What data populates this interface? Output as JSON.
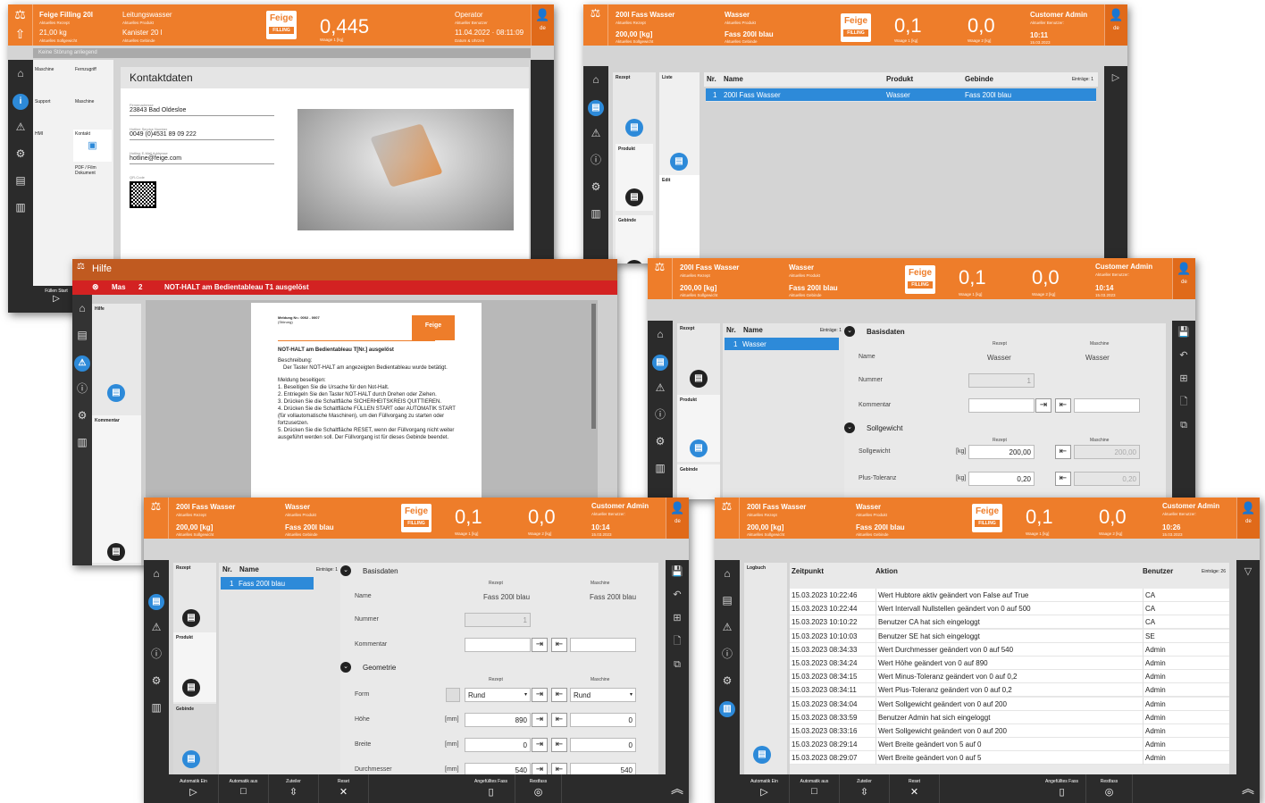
{
  "s1": {
    "title": "Feige Filling 20l",
    "title_sub": "Aktuelles Rezept",
    "prod": "Leitungswasser",
    "prod_sub": "Aktuelles Produkt",
    "sw": "21,00 kg",
    "sw_sub": "Aktuelles Sollgewicht",
    "geb": "Kanister 20 l",
    "geb_sub": "Aktuelles Gebinde",
    "weight": "0,445",
    "weight_sub": "Waage 1 [kg]",
    "user": "Operator",
    "user_sub": "Aktueller Benutzer",
    "date": "11.04.2022 · 08:11:09",
    "date_sub": "Datum & Uhrzeit",
    "lang": "de",
    "status": "Keine Störung anliegend",
    "nav": [
      "Maschine",
      "Fernzugriff",
      "Support",
      "Maschine",
      "HMI",
      "Kontakt",
      "PDF / Film Dokument"
    ],
    "heading": "Kontaktdaten",
    "fields": [
      {
        "l": "Firmenadresse",
        "v": "23843 Bad Oldesloe"
      },
      {
        "l": "Hotline Service Number",
        "v": "0049 (0)4531 89 09 222"
      },
      {
        "l": "Hotline E-Mail Addresse",
        "v": "hotline@feige.com"
      },
      {
        "l": "QR-Code",
        "v": ""
      }
    ],
    "fbtn": "Füllen Start"
  },
  "s2": {
    "r": "200l Fass Wasser",
    "r_sub": "Aktuelles Rezept",
    "p": "Wasser",
    "p_sub": "Aktuelles Produkt",
    "sw": "200,00 [kg]",
    "sw_sub": "Aktuelles Sollgewicht",
    "g": "Fass 200l blau",
    "g_sub": "Aktuelles Gebinde",
    "w1": "0,1",
    "w1s": "Waage 1 [kg]",
    "w2": "0,0",
    "w2s": "Waage 2 [kg]",
    "user": "Customer Admin",
    "user_sub": "Aktueller Benutzer:",
    "time": "10:11",
    "date": "15.03.2023",
    "lang": "de",
    "cats": [
      "Rezept",
      "Produkt",
      "Gebinde"
    ],
    "sub": [
      "Liste",
      "Edit"
    ],
    "cols": [
      "Nr.",
      "Name",
      "Produkt",
      "Gebinde"
    ],
    "entries": "Einträge: 1",
    "row": [
      "1",
      "200l Fass Wasser",
      "Wasser",
      "Fass 200l blau"
    ]
  },
  "s3": {
    "title": "Hilfe",
    "err_code": "Mas",
    "err_num": "2",
    "err_text": "NOT-HALT am Bedientableau T1 ausgelöst",
    "cats": [
      "Hilfe",
      "Kommentar"
    ],
    "doc": {
      "meldung": "Meldung Nr.: 0002 - 0007",
      "stoerung": "(Störung)",
      "h": "NOT-HALT am Bedientableau T[Nr.] ausgelöst",
      "b": "Beschreibung:",
      "b1": "Der Taster NOT-HALT am angezeigten Bedientableau wurde betätigt.",
      "m": "Meldung beseitigen:",
      "steps": [
        "1. Beseitigen Sie die Ursache für den Not-Halt.",
        "2. Entriegeln Sie den Taster NOT-HALT durch Drehen oder Ziehen.",
        "3. Drücken Sie die Schaltfläche SICHERHEITSKREIS QUITTIEREN.",
        "4. Drücken Sie die Schaltfläche FÜLLEN START oder AUTOMATIK START (für vollautomatische Maschinen), um den Füllvorgang zu starten oder fortzusetzen.",
        "5. Drücken Sie die Schaltfläche RESET, wenn der Füllvorgang nicht weiter ausgeführt werden soll. Der Füllvorgang ist für dieses Gebinde beendet."
      ]
    }
  },
  "s4": {
    "r": "200l Fass Wasser",
    "p": "Wasser",
    "sw": "200,00 [kg]",
    "g": "Fass 200l blau",
    "w1": "0,1",
    "w2": "0,0",
    "user": "Customer Admin",
    "time": "10:14",
    "date": "15.03.2023",
    "entries": "Einträge: 1",
    "name": "Wasser",
    "sec1": "Basisdaten",
    "sec2": "Sollgewicht",
    "col_r": "Rezept",
    "col_m": "Maschine",
    "name_l": "Name",
    "num_l": "Nummer",
    "kom_l": "Kommentar",
    "num_v": "1",
    "sg_l": "Sollgewicht",
    "sg_u": "[kg]",
    "sg_v": "200,00",
    "sg_m": "200,00",
    "pt_l": "Plus-Toleranz",
    "pt_u": "[kg]",
    "pt_v": "0,20",
    "pt_m": "0,20",
    "cats": [
      "Rezept",
      "Produkt",
      "Gebinde"
    ]
  },
  "s5": {
    "r": "200l Fass Wasser",
    "p": "Wasser",
    "sw": "200,00 [kg]",
    "g": "Fass 200l blau",
    "w1": "0,1",
    "w2": "0,0",
    "user": "Customer Admin",
    "time": "10:14",
    "date": "15.03.2023",
    "name": "Fass 200l blau",
    "sec1": "Basisdaten",
    "sec2": "Geometrie",
    "form_l": "Form",
    "form_v": "Rund",
    "h_l": "Höhe",
    "h_u": "[mm]",
    "h_v": "890",
    "h_m": "0",
    "b_l": "Breite",
    "b_u": "[mm]",
    "b_v": "0",
    "b_m": "0",
    "d_l": "Durchmesser",
    "d_u": "[mm]",
    "d_v": "540",
    "d_m": "540",
    "bot": [
      "Automatik Ein",
      "Automatik aus",
      "Zuteiler",
      "Reset",
      "Angefülltes Fass",
      "Restfass"
    ]
  },
  "s6": {
    "r": "200l Fass Wasser",
    "p": "Wasser",
    "sw": "200,00 [kg]",
    "g": "Fass 200l blau",
    "w1": "0,1",
    "w2": "0,0",
    "user": "Customer Admin",
    "time": "10:26",
    "date": "15.03.2023",
    "cat": "Logbuch",
    "cols": [
      "Zeitpunkt",
      "Aktion",
      "Benutzer"
    ],
    "entries": "Einträge: 26",
    "rows": [
      [
        "15.03.2023 10:22:46",
        "Wert Hubtore aktiv geändert von False auf True",
        "CA"
      ],
      [
        "15.03.2023 10:22:44",
        "Wert Intervall Nullstellen geändert von 0 auf 500",
        "CA"
      ],
      [
        "15.03.2023 10:10:22",
        "Benutzer CA hat sich eingeloggt",
        "CA"
      ],
      [
        "15.03.2023 10:10:03",
        "Benutzer SE hat sich eingeloggt",
        "SE"
      ],
      [
        "15.03.2023 08:34:33",
        "Wert Durchmesser geändert von 0 auf 540",
        "Admin"
      ],
      [
        "15.03.2023 08:34:24",
        "Wert Höhe geändert von 0 auf 890",
        "Admin"
      ],
      [
        "15.03.2023 08:34:15",
        "Wert Minus-Toleranz geändert von 0 auf 0,2",
        "Admin"
      ],
      [
        "15.03.2023 08:34:11",
        "Wert Plus-Toleranz geändert von 0 auf 0,2",
        "Admin"
      ],
      [
        "15.03.2023 08:34:04",
        "Wert Sollgewicht geändert von 0 auf 200",
        "Admin"
      ],
      [
        "15.03.2023 08:33:59",
        "Benutzer Admin hat sich eingeloggt",
        "Admin"
      ],
      [
        "15.03.2023 08:33:16",
        "Wert Sollgewicht geändert von 0 auf 200",
        "Admin"
      ],
      [
        "15.03.2023 08:29:14",
        "Wert Breite geändert von 5 auf 0",
        "Admin"
      ],
      [
        "15.03.2023 08:29:07",
        "Wert Breite geändert von 0 auf 5",
        "Admin"
      ]
    ],
    "bot": [
      "Automatik Ein",
      "Automatik aus",
      "Zuteiler",
      "Reset",
      "Angefülltes Fass",
      "Restfass"
    ]
  }
}
